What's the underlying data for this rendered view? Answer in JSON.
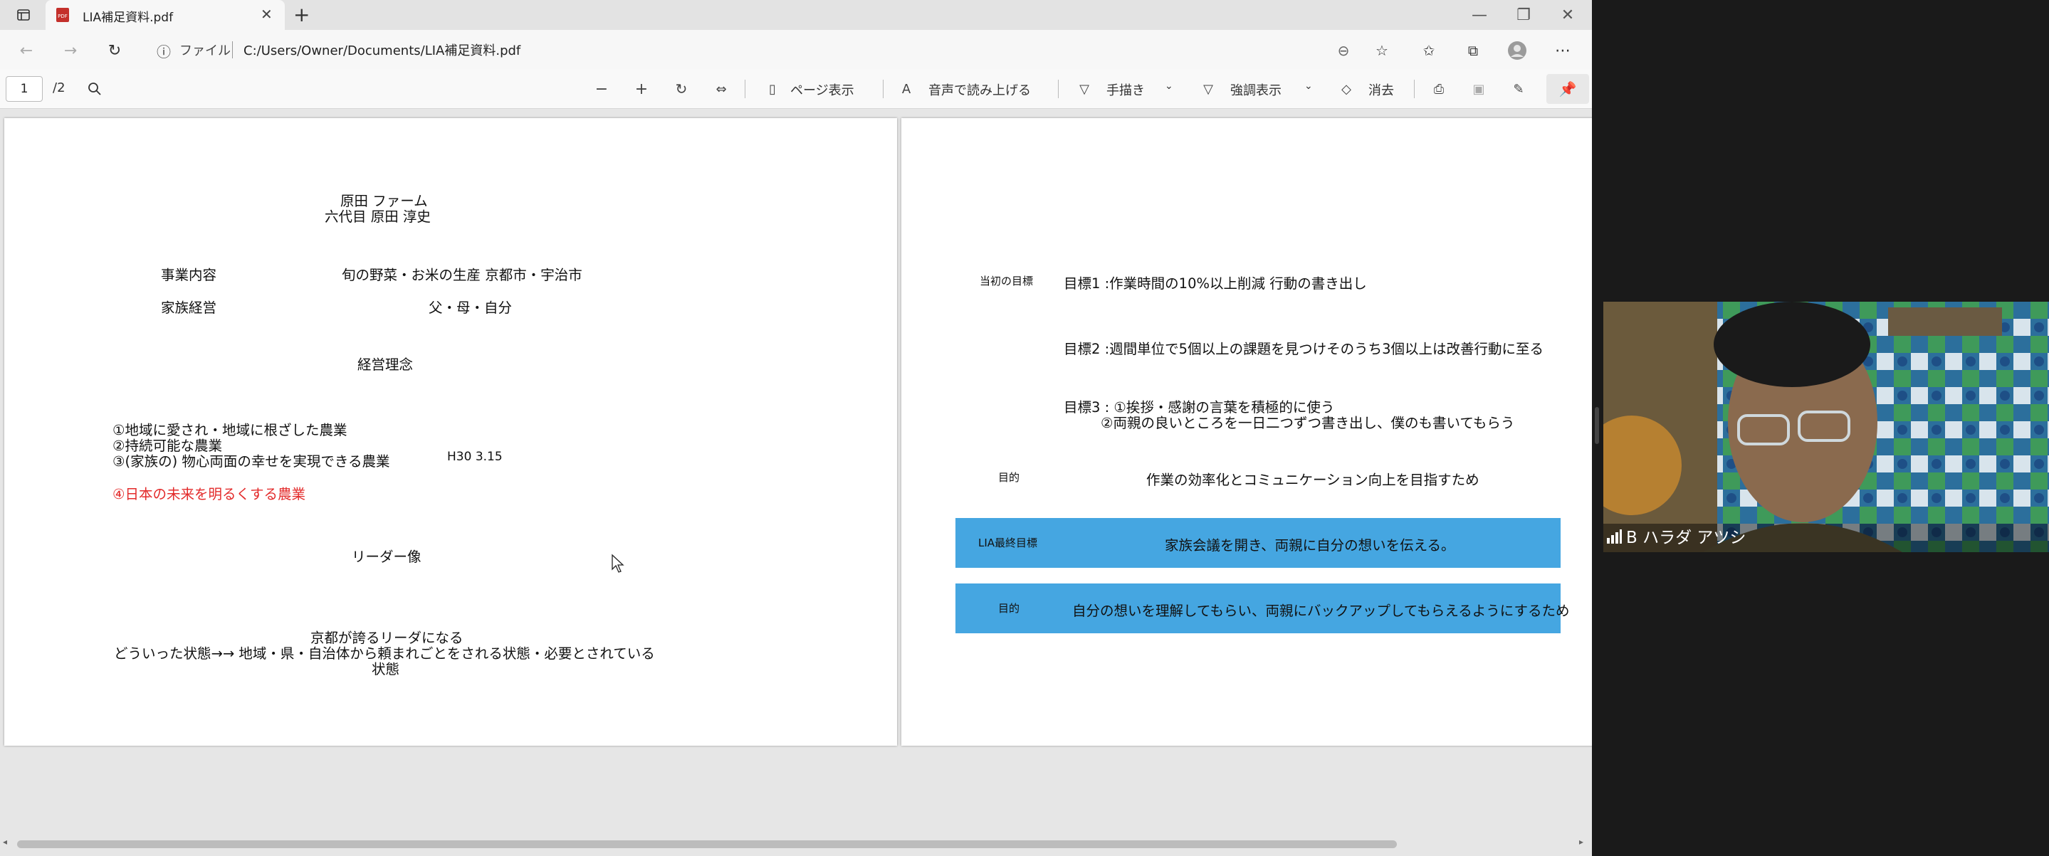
{
  "browser": {
    "tab_title": "LIA補足資料.pdf",
    "address_label": "ファイル",
    "address": "C:/Users/Owner/Documents/LIA補足資料.pdf"
  },
  "pdf_toolbar": {
    "page_current": "1",
    "page_total": "/2",
    "page_view": "ページ表示",
    "read_aloud": "音声で読み上げる",
    "draw": "手描き",
    "highlight": "強調表示",
    "erase": "消去"
  },
  "page1": {
    "title1": "原田 ファーム",
    "title2": "六代目 原田 淳史",
    "business_label": "事業内容",
    "business_value": "旬の野菜・お米の生産 京都市・宇治市",
    "family_label": "家族経営",
    "family_value": "父・母・自分",
    "philosophy_heading": "経営理念",
    "principle1": "①地域に愛され・地域に根ざした農業",
    "principle2": "②持続可能な農業",
    "principle3": "③(家族の) 物心両面の幸せを実現できる農業",
    "principle3_date": "H30 3.15",
    "principle4": "④日本の未来を明るくする農業",
    "leader_heading": "リーダー像",
    "leader_line1": "京都が誇るリーダになる",
    "leader_line2": "どういった状態→→ 地域・県・自治体から頼まれごとをされる状態・必要とされている",
    "leader_line3": "状態"
  },
  "page2": {
    "initial_goal_label": "当初の目標",
    "goal1": "目標1 :作業時間の10%以上削減 行動の書き出し",
    "goal2": "目標2 :週間単位で5個以上の課題を見つけそのうち3個以上は改善行動に至る",
    "goal3_line1": "目標3 : ①挨拶・感謝の言葉を積極的に使う",
    "goal3_line2": "②両親の良いところを一日二つずつ書き出し、僕のも書いてもらう",
    "purpose_label": "目的",
    "purpose": "作業の効率化とコミュニケーション向上を目指すため",
    "lia_label": "LIA最終目標",
    "lia_goal": "家族会議を開き、両親に自分の想いを伝える。",
    "purpose2_label": "目的",
    "purpose2": "自分の想いを理解してもらい、両親にバックアップしてもらえるようにするため"
  },
  "video": {
    "participant_name": "B ハラダ アツシ"
  },
  "colors": {
    "blue_row": "#45a6e1",
    "red_text": "#e32b2b"
  }
}
